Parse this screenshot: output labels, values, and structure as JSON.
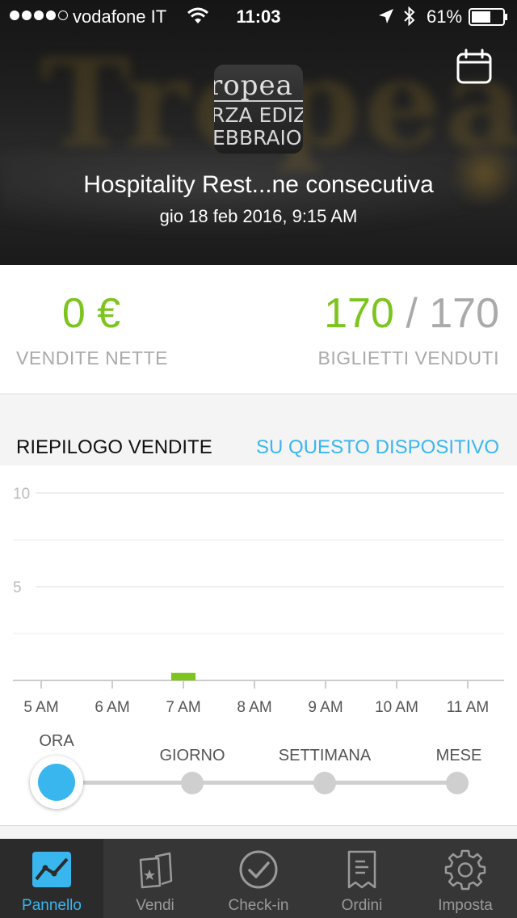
{
  "status_bar": {
    "carrier": "vodafone IT",
    "time": "11:03",
    "battery": "61%",
    "signal_bars": 4,
    "signal_max": 5
  },
  "header": {
    "logo_lines": [
      "ropea",
      "RZA EDIZIO",
      "EBBRAIO"
    ],
    "event_title": "Hospitality Rest...ne consecutiva",
    "event_date": "gio 18 feb 2016, 9:15 AM",
    "calendar_icon": "calendar-icon"
  },
  "stats": {
    "net_sales_value": "0 €",
    "net_sales_label": "VENDITE NETTE",
    "tickets_sold": "170",
    "tickets_separator": "/",
    "tickets_total": "170",
    "tickets_label": "BIGLIETTI VENDUTI"
  },
  "summary": {
    "title": "RIEPILOGO VENDITE",
    "device_link": "SU QUESTO DISPOSITIVO"
  },
  "chart_data": {
    "type": "bar",
    "categories": [
      "5 AM",
      "6 AM",
      "7 AM",
      "8 AM",
      "9 AM",
      "10 AM",
      "11 AM"
    ],
    "values": [
      0,
      0,
      0.4,
      0,
      0,
      0,
      0
    ],
    "ylim": [
      0,
      10
    ],
    "yticks": [
      "10",
      "5"
    ],
    "ytick_values": [
      10,
      5
    ],
    "grid": true,
    "bar_color": "#7dc41e",
    "title": "",
    "xlabel": "",
    "ylabel": ""
  },
  "period": {
    "options": [
      "ORA",
      "GIORNO",
      "SETTIMANA",
      "MESE"
    ],
    "selected": "ORA",
    "active_color": "#3ab6ef"
  },
  "tabs": [
    {
      "label": "Pannello",
      "icon": "dashboard-chart-icon",
      "active": true
    },
    {
      "label": "Vendi",
      "icon": "tickets-icon",
      "active": false
    },
    {
      "label": "Check-in",
      "icon": "check-circle-icon",
      "active": false
    },
    {
      "label": "Ordini",
      "icon": "receipt-icon",
      "active": false
    },
    {
      "label": "Imposta",
      "icon": "gear-icon",
      "active": false
    }
  ]
}
